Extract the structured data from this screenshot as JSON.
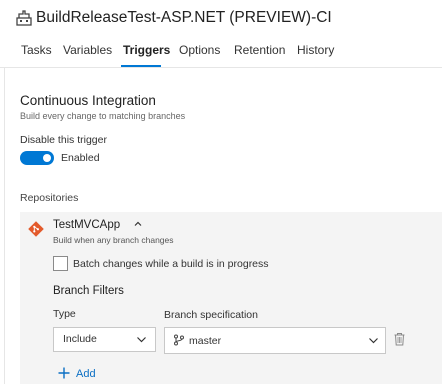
{
  "header": {
    "title": "BuildReleaseTest-ASP.NET (PREVIEW)-CI",
    "icon": "build-pipeline-icon"
  },
  "tabs": [
    {
      "label": "Tasks",
      "active": false
    },
    {
      "label": "Variables",
      "active": false
    },
    {
      "label": "Triggers",
      "active": true
    },
    {
      "label": "Options",
      "active": false
    },
    {
      "label": "Retention",
      "active": false
    },
    {
      "label": "History",
      "active": false
    }
  ],
  "ci": {
    "title": "Continuous Integration",
    "subtitle": "Build every change to matching branches",
    "disable_label": "Disable this trigger",
    "toggle_state": "Enabled",
    "toggle_on": true
  },
  "repositories": {
    "label": "Repositories",
    "repo": {
      "name": "TestMVCApp",
      "subtitle": "Build when any branch changes",
      "icon": "git-icon",
      "batch_label": "Batch changes while a build is in progress",
      "batch_checked": false,
      "branch_filters": {
        "title": "Branch Filters",
        "type_label": "Type",
        "spec_label": "Branch specification",
        "filters": [
          {
            "type": "Include",
            "spec": "master"
          }
        ],
        "add_label": "Add"
      }
    }
  },
  "colors": {
    "accent": "#0078d4",
    "git": "#e35a2b",
    "panel": "#f4f4f4"
  }
}
